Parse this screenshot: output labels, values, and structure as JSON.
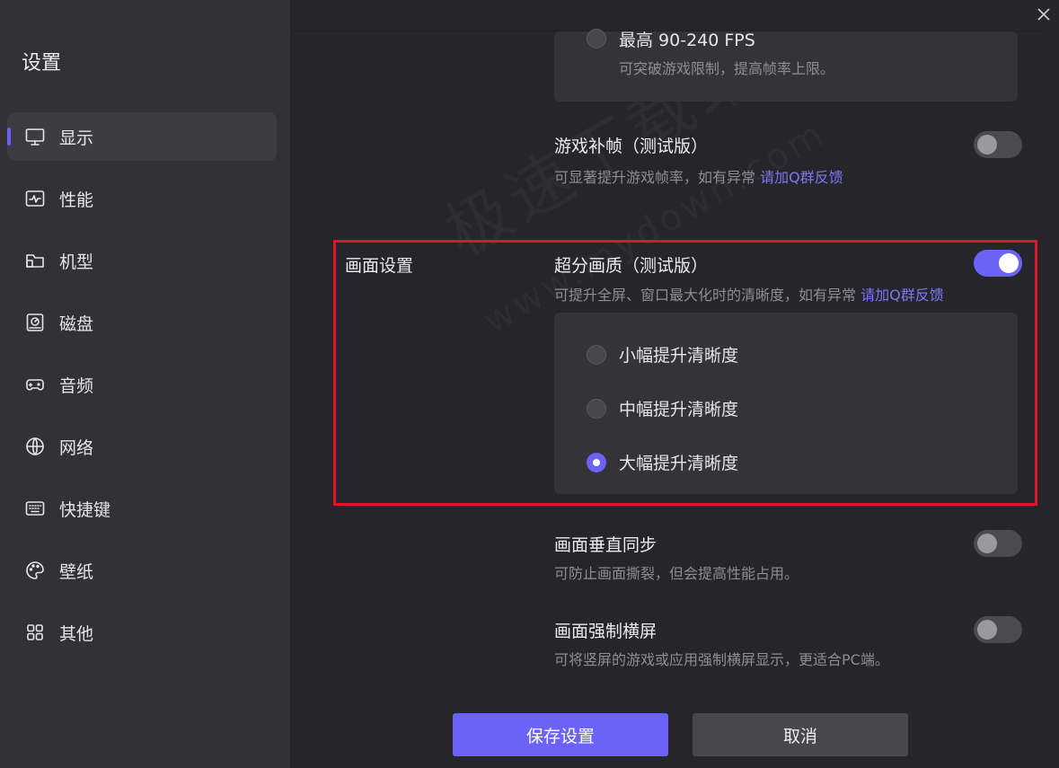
{
  "sidebar": {
    "title": "设置",
    "items": [
      {
        "label": "显示",
        "icon": "monitor-icon"
      },
      {
        "label": "性能",
        "icon": "performance-icon"
      },
      {
        "label": "机型",
        "icon": "folder-icon"
      },
      {
        "label": "磁盘",
        "icon": "disk-icon"
      },
      {
        "label": "音频",
        "icon": "gamepad-icon"
      },
      {
        "label": "网络",
        "icon": "globe-icon"
      },
      {
        "label": "快捷键",
        "icon": "keyboard-icon"
      },
      {
        "label": "壁纸",
        "icon": "palette-icon"
      },
      {
        "label": "其他",
        "icon": "grid-icon"
      }
    ]
  },
  "fps": {
    "option_label": "最高 90-240 FPS",
    "option_desc": "可突破游戏限制，提高帧率上限。"
  },
  "frame_interp": {
    "title": "游戏补帧（测试版）",
    "desc": "可显著提升游戏帧率，如有异常",
    "link": "请加Q群反馈",
    "enabled": false
  },
  "picture_section": {
    "label": "画面设置",
    "super_res": {
      "title": "超分画质（测试版）",
      "desc": "可提升全屏、窗口最大化时的清晰度，如有异常",
      "link": "请加Q群反馈",
      "enabled": true,
      "options": [
        "小幅提升清晰度",
        "中幅提升清晰度",
        "大幅提升清晰度"
      ],
      "selected": "大幅提升清晰度"
    }
  },
  "vsync": {
    "title": "画面垂直同步",
    "desc": "可防止画面撕裂，但会提高性能占用。",
    "enabled": false
  },
  "landscape": {
    "title": "画面强制横屏",
    "desc": "可将竖屏的游戏或应用强制横屏显示，更适合PC端。",
    "enabled": false
  },
  "buttons": {
    "save": "保存设置",
    "cancel": "取消"
  },
  "watermark": {
    "text_cn": "极速下载站",
    "text_en": "www.mydown.com"
  },
  "colors": {
    "accent": "#6b63f5",
    "highlight_border": "#e0142a",
    "link": "#7c77f2"
  }
}
